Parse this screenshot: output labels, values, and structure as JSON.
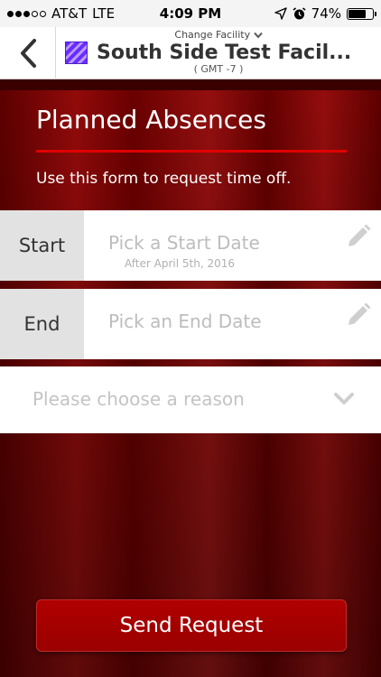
{
  "status_bar": {
    "carrier": "AT&T",
    "network": "LTE",
    "time": "4:09 PM",
    "battery": "74%",
    "battery_level": 0.74
  },
  "header": {
    "change_facility_label": "Change Facility",
    "facility_name": "South Side Test Facil...",
    "timezone": "( GMT -7 )",
    "facility_color": "#6a2bff"
  },
  "form": {
    "title": "Planned Absences",
    "subtitle": "Use this form to request time off.",
    "start": {
      "label": "Start",
      "placeholder": "Pick a Start Date",
      "hint": "After April 5th, 2016"
    },
    "end": {
      "label": "End",
      "placeholder": "Pick an End Date"
    },
    "reason": {
      "placeholder": "Please choose a reason"
    },
    "submit_label": "Send Request"
  },
  "colors": {
    "accent_red": "#e00000",
    "button_red": "#b00000"
  }
}
